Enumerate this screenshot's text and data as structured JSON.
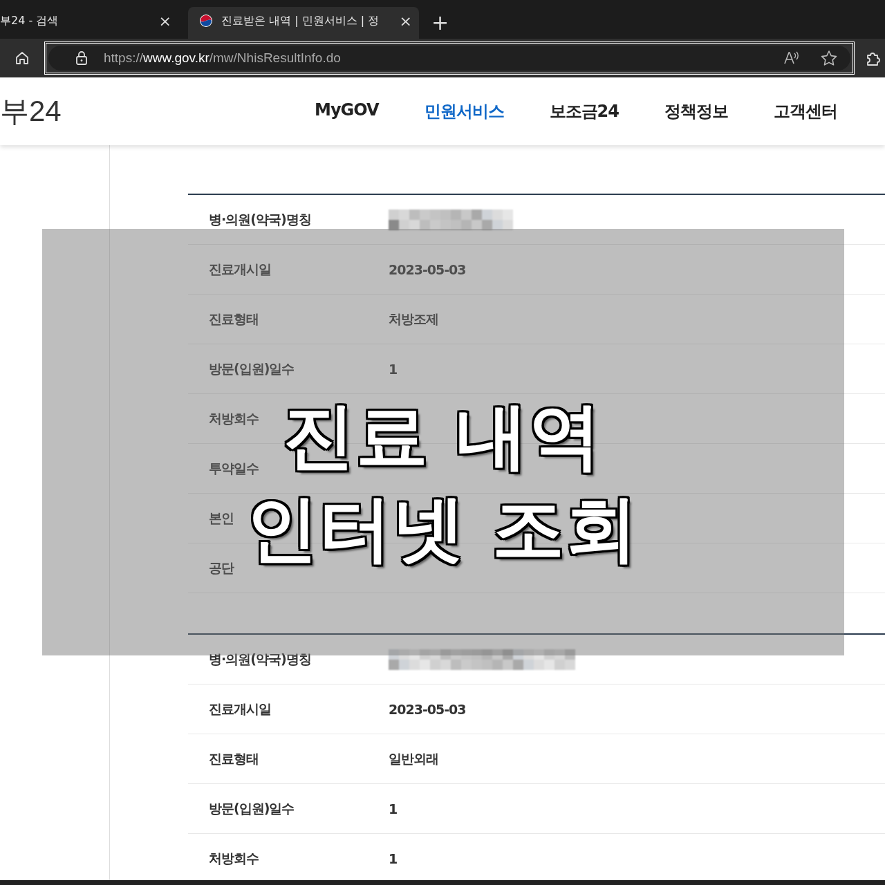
{
  "browser": {
    "tabs": [
      {
        "title": "부24 - 검색",
        "close": "×",
        "selected": false,
        "favicon": false
      },
      {
        "title": "진료받은 내역 | 민원서비스 | 정",
        "close": "×",
        "selected": true,
        "favicon": true
      }
    ],
    "new_tab": "+",
    "url": {
      "scheme": "https://",
      "host": "www.gov.kr",
      "path": "/mw/NhisResultInfo.do"
    }
  },
  "site": {
    "logo": "부24",
    "nav": [
      {
        "label": "MyGOV",
        "selected": false
      },
      {
        "label": "민원서비스",
        "selected": true
      },
      {
        "label": "보조금24",
        "selected": false
      },
      {
        "label": "정책정보",
        "selected": false
      },
      {
        "label": "고객센터",
        "selected": false
      }
    ]
  },
  "records": [
    {
      "rows": [
        {
          "label": "병·의원(약국)명칭",
          "redacted": true
        },
        {
          "label": "진료개시일",
          "value": "2023-05-03"
        },
        {
          "label": "진료형태",
          "value": "처방조제"
        },
        {
          "label": "방문(입원)일수",
          "value": "1"
        },
        {
          "label": "처방회수"
        },
        {
          "label": "투약일수"
        },
        {
          "label": "본인"
        },
        {
          "label": "공단"
        }
      ]
    },
    {
      "rows": [
        {
          "label": "병·의원(약국)명칭",
          "redacted": true
        },
        {
          "label": "진료개시일",
          "value": "2023-05-03"
        },
        {
          "label": "진료형태",
          "value": "일반외래"
        },
        {
          "label": "방문(입원)일수",
          "value": "1"
        },
        {
          "label": "처방회수",
          "value": "1"
        }
      ]
    }
  ],
  "overlay": {
    "lines": [
      "진료 내역",
      "인터넷 조회"
    ]
  }
}
